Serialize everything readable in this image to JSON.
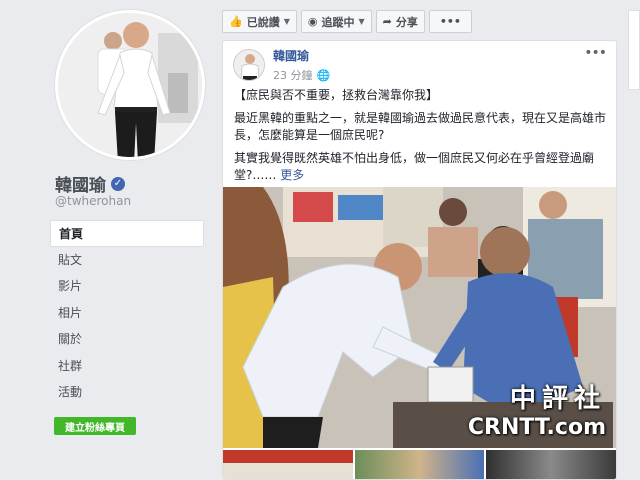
{
  "profile": {
    "name": "韓國瑜",
    "handle": "@twherohan"
  },
  "nav": {
    "items": [
      {
        "label": "首頁",
        "active": true
      },
      {
        "label": "貼文"
      },
      {
        "label": "影片"
      },
      {
        "label": "相片"
      },
      {
        "label": "關於"
      },
      {
        "label": "社群"
      },
      {
        "label": "活動"
      }
    ],
    "create_page_label": "建立粉絲專頁"
  },
  "actionbar": {
    "liked_label": "已說讚",
    "following_label": "追蹤中",
    "share_label": "分享"
  },
  "post": {
    "author": "韓國瑜",
    "time": "23 分鐘",
    "paragraphs": [
      "【庶民與否不重要，拯救台灣靠你我】",
      "最近黑韓的重點之一，就是韓國瑜過去做過民意代表，現在又是高雄市長，怎麼能算是一個庶民呢?",
      "其實我覺得既然英雄不怕出身低，做一個庶民又何必在乎曾經登過廟堂?……"
    ],
    "see_more": "更多"
  },
  "watermark": {
    "line1": "中評社",
    "line2": "CRNTT.com"
  },
  "colors": {
    "link": "#365899",
    "brand": "#4267b2",
    "green": "#42b72a"
  }
}
